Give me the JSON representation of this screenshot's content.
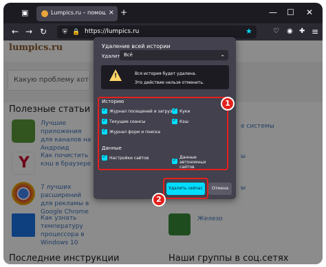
{
  "browser": {
    "tab_title": "Lumpics.ru – помощь с компь",
    "url": "https://lumpics.ru"
  },
  "page": {
    "logo": "lumpics.ru",
    "search_placeholder": "Какую проблему хотите р",
    "section_articles": "Полезные статьи",
    "articles": [
      "Лучшие приложения для каналов на Андроид",
      "Как почистить кэш в браузере",
      "7 лучших расширений для рекламы в Google Chrome",
      "Как узнать температуру процессора в Windows 10"
    ],
    "right_links": [
      "е системы",
      "ы",
      "ы",
      "Железо"
    ],
    "section_instructions": "Последние инструкции",
    "section_groups": "Наши группы в соц.сетях"
  },
  "dialog": {
    "title": "Удаление всей истории",
    "delete_label": "Удалить:",
    "delete_value": "Всё",
    "warning_line1": "Вся история будет удалена.",
    "warning_line2": "Это действие нельзя отменить.",
    "history_title": "Историю",
    "history_items": [
      "Журнал посещений и загрузок",
      "Текущие сеансы",
      "Журнал форм и поиска",
      "Куки",
      "Кэш"
    ],
    "data_title": "Данные",
    "data_items": [
      "Настройки сайтов",
      "Данные автономных сайтов"
    ],
    "delete_button": "Удалить сейчас",
    "cancel_button": "Отмена"
  },
  "annotations": {
    "step1": "1",
    "step2": "2",
    "color": "#e5201c"
  }
}
